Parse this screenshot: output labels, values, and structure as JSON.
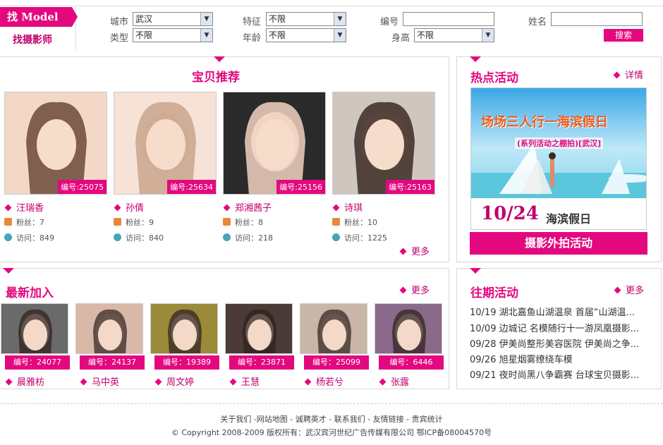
{
  "logo": {
    "find_model": "找 Model",
    "find_photographer": "找摄影师"
  },
  "filters": {
    "city_label": "城市",
    "city_value": "武汉",
    "type_label": "类型",
    "type_value": "不限",
    "feature_label": "特征",
    "feature_value": "不限",
    "age_label": "年龄",
    "age_value": "不限",
    "number_label": "编号",
    "number_value": "",
    "height_label": "身高",
    "height_value": "不限",
    "name_label": "姓名",
    "name_value": "",
    "search_label": "搜索"
  },
  "recommend": {
    "title": "宝贝推荐",
    "more": "更多",
    "fans_label": "粉丝：",
    "visits_label": "访问：",
    "items": [
      {
        "id": "编号:25075",
        "name": "汪瑞香",
        "fans": "7",
        "visits": "849"
      },
      {
        "id": "编号:25634",
        "name": "孙倩",
        "fans": "9",
        "visits": "840"
      },
      {
        "id": "编号:25156",
        "name": "郑湘茜子",
        "fans": "8",
        "visits": "218"
      },
      {
        "id": "编号:25163",
        "name": "诗琪",
        "fans": "10",
        "visits": "1225"
      }
    ]
  },
  "hot": {
    "title": "热点活动",
    "detail": "详情",
    "banner_headline": "场场三人行一海滨假日",
    "banner_sub": "(系列活动之棚拍)[武汉]",
    "date": "10/24",
    "event": "海滨假日",
    "button": "摄影外拍活动"
  },
  "newest": {
    "title": "最新加入",
    "more": "更多",
    "items": [
      {
        "id": "编号：24077",
        "name": "晨雅枋"
      },
      {
        "id": "编号：24137",
        "name": "马中英"
      },
      {
        "id": "编号：19389",
        "name": "周文婷"
      },
      {
        "id": "编号：23871",
        "name": "王慧"
      },
      {
        "id": "编号：25099",
        "name": "杨若兮"
      },
      {
        "id": "编号：6446",
        "name": "张露"
      }
    ]
  },
  "past": {
    "title": "往期活动",
    "more": "更多",
    "items": [
      "10/19 湖北嘉鱼山湖温泉 首届“山湖温...",
      "10/09 边城记 名模随行十一游凤凰摄影...",
      "09/28 伊美尚整形美容医院 伊美尚之争...",
      "09/26 旭星烟雾缭绕车模",
      "09/21 夜时尚黑八争霸赛 台球宝贝摄影..."
    ]
  },
  "footer": {
    "links": "关于我们 -网站地图 - 诚聘英才 - 联系我们 - 友情链接 - 贵宾统计",
    "copyright": "© Copyright 2008-2009 版权所有：武汉宾河世纪广告传媒有限公司 鄂ICP备08004570号"
  },
  "colors": {
    "accent": "#e4087f",
    "accent_dark": "#c2006f"
  }
}
